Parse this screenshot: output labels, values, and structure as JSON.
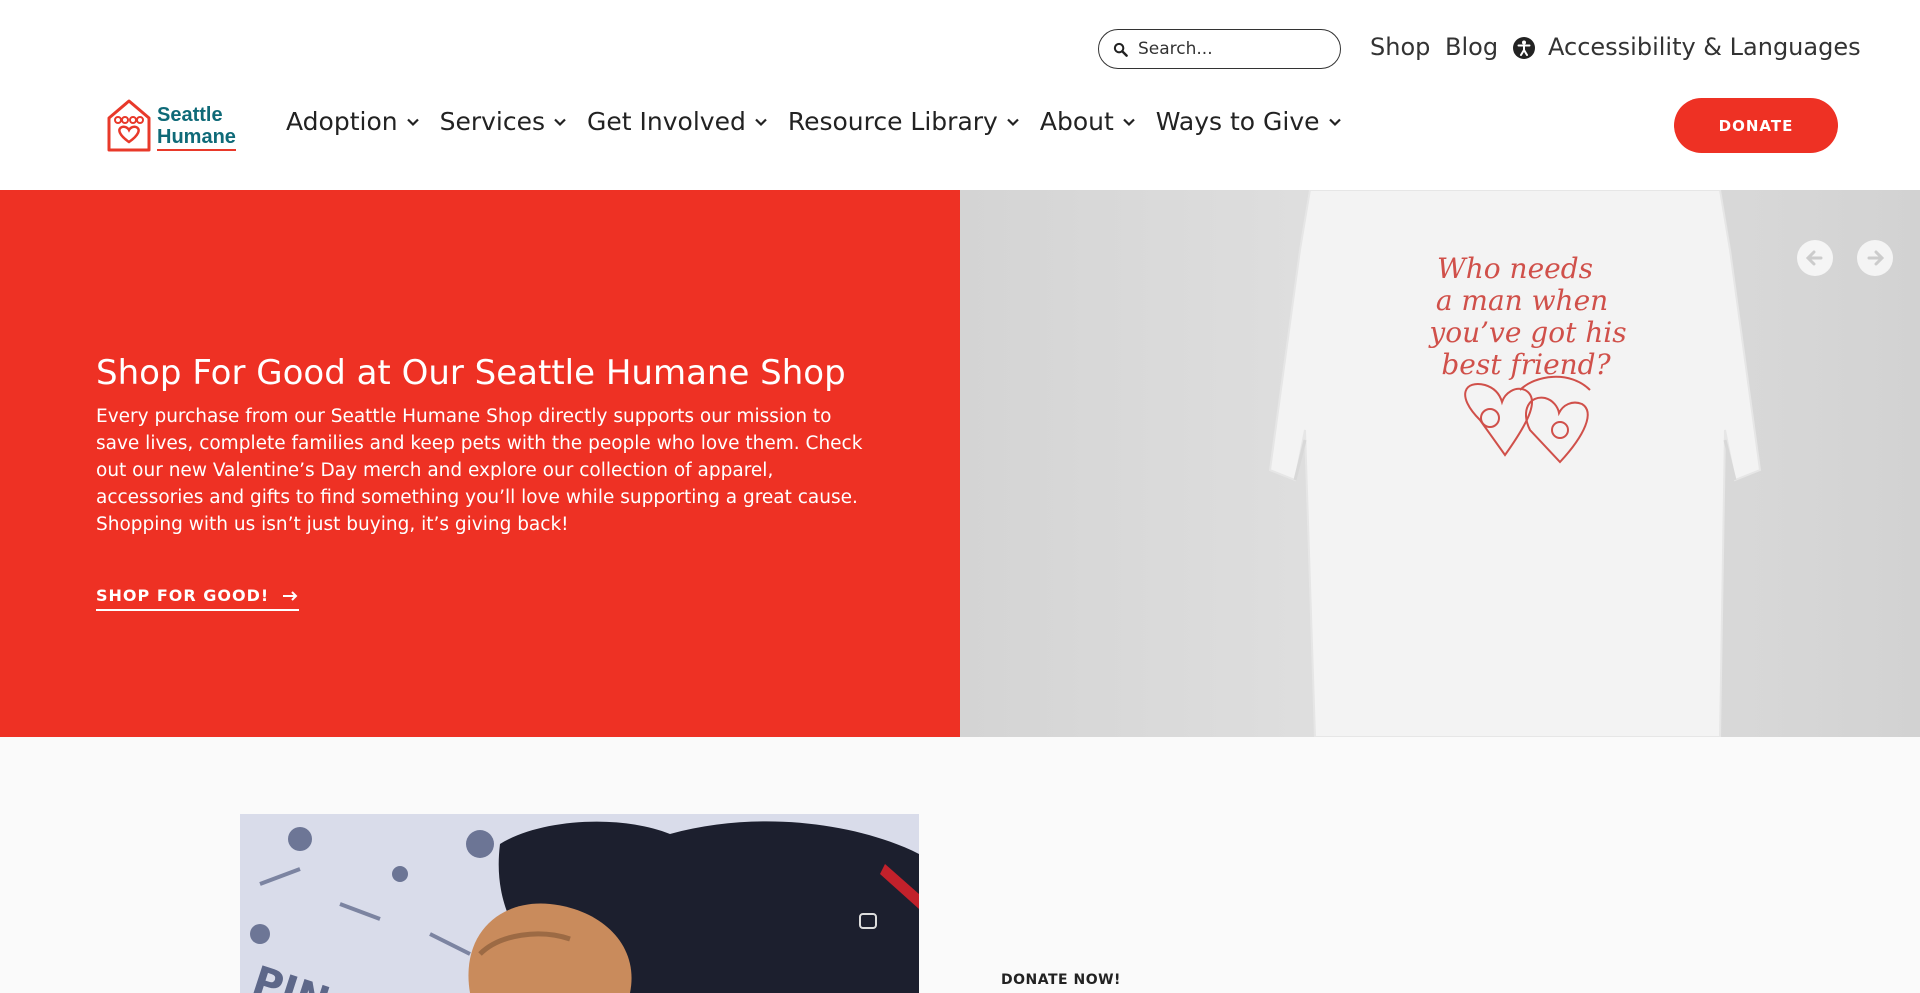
{
  "header": {
    "search_placeholder": "Search...",
    "util_links": {
      "shop": "Shop",
      "blog": "Blog",
      "accessibility": "Accessibility & Languages"
    },
    "logo": {
      "line1": "Seattle",
      "line2": "Humane"
    },
    "nav": [
      "Adoption",
      "Services",
      "Get Involved",
      "Resource Library",
      "About",
      "Ways to Give"
    ],
    "donate_label": "DONATE"
  },
  "hero": {
    "title": "Shop For Good at Our Seattle Humane Shop",
    "body": "Every purchase from our Seattle Humane Shop directly supports our mission to save lives, complete families and keep pets with the people who love them. Check out our new Valentine’s Day merch and explore our collection of apparel, accessories and gifts to find something you’ll love while supporting a great cause. Shopping with us isn’t just buying, it’s giving back!",
    "cta": "SHOP FOR GOOD!",
    "shirt_text": [
      "Who needs",
      "a man when",
      "you’ve got his",
      "best friend?"
    ]
  },
  "lower": {
    "donate_now": "DONATE NOW!",
    "puppy_label": "PIN"
  },
  "colors": {
    "brand_red": "#ee3124",
    "brand_teal": "#0f6a78"
  },
  "icons": [
    "search-icon",
    "accessibility-icon",
    "chevron-down-icon",
    "arrow-left-icon",
    "arrow-right-icon",
    "arrow-right-small-icon"
  ]
}
